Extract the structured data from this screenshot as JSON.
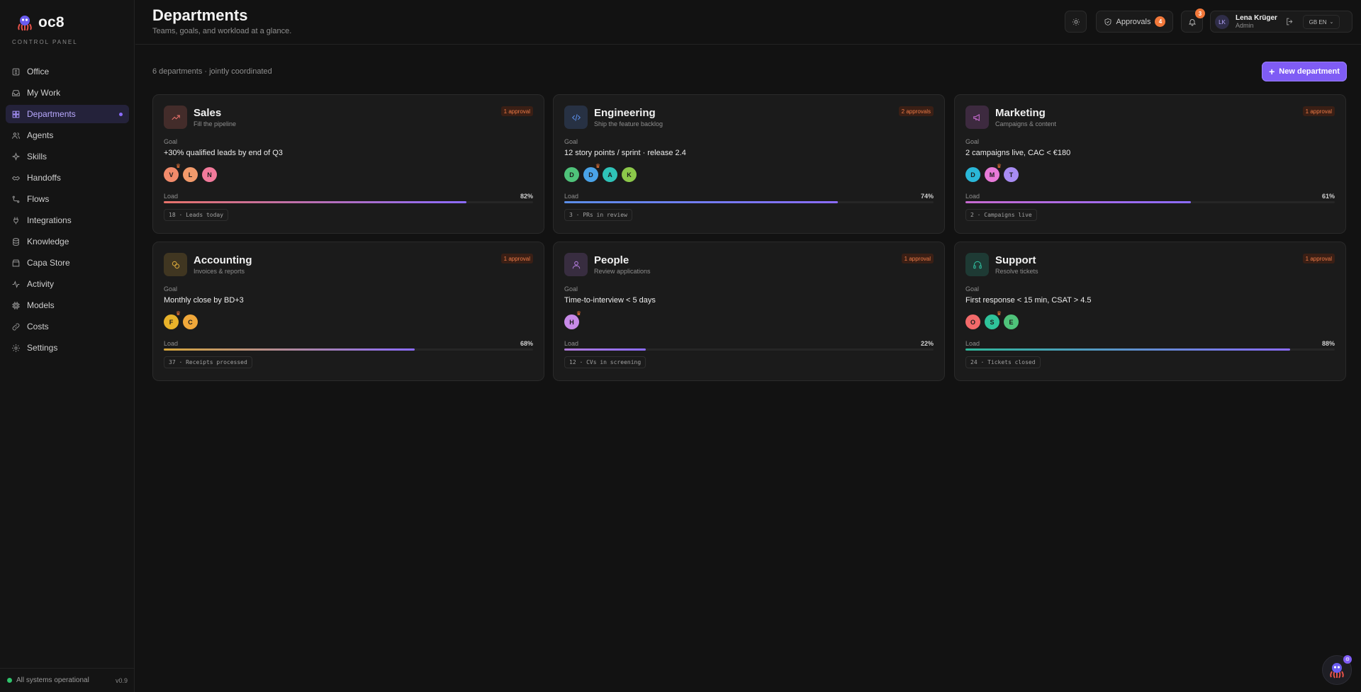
{
  "brand": {
    "name": "oc8",
    "subtitle": "CONTROL PANEL",
    "logo_icon": "octopus-icon"
  },
  "sidebar": {
    "items": [
      {
        "label": "Office",
        "icon": "office-icon"
      },
      {
        "label": "My Work",
        "icon": "inbox-icon"
      },
      {
        "label": "Departments",
        "icon": "grid-icon",
        "active": true
      },
      {
        "label": "Agents",
        "icon": "users-icon"
      },
      {
        "label": "Skills",
        "icon": "sparkle-icon"
      },
      {
        "label": "Handoffs",
        "icon": "handshake-icon"
      },
      {
        "label": "Flows",
        "icon": "flow-icon"
      },
      {
        "label": "Integrations",
        "icon": "plug-icon"
      },
      {
        "label": "Knowledge",
        "icon": "database-icon"
      },
      {
        "label": "Capa Store",
        "icon": "store-icon"
      },
      {
        "label": "Activity",
        "icon": "activity-icon"
      },
      {
        "label": "Models",
        "icon": "cpu-icon"
      },
      {
        "label": "Costs",
        "icon": "link-icon"
      },
      {
        "label": "Settings",
        "icon": "gear-icon"
      }
    ],
    "status": "All systems operational",
    "version": "v0.9"
  },
  "header": {
    "title": "Departments",
    "subtitle": "Teams, goals, and workload at a glance.",
    "approvals_label": "Approvals",
    "approvals_count": "4",
    "notifications_count": "3",
    "user": {
      "initials": "LK",
      "name": "Lena Krüger",
      "role": "Admin"
    },
    "language": "GB EN"
  },
  "main": {
    "count_text": "6 departments · jointly coordinated",
    "new_button": "New department"
  },
  "departments": [
    {
      "name": "Sales",
      "sub": "Fill the pipeline",
      "approvals": "1 approval",
      "goal_label": "Goal",
      "goal": "+30% qualified leads by end of Q3",
      "members": [
        {
          "i": "V",
          "c": "#f28b6b",
          "crown": true
        },
        {
          "i": "L",
          "c": "#f29a6b"
        },
        {
          "i": "N",
          "c": "#f27a9b"
        }
      ],
      "load_label": "Load",
      "load": 82,
      "load_text": "82%",
      "tag": "18 · Leads today",
      "accent": "#e8726a",
      "icon": "trending-up-icon"
    },
    {
      "name": "Engineering",
      "sub": "Ship the feature backlog",
      "approvals": "2 approvals",
      "goal_label": "Goal",
      "goal": "12 story points / sprint · release 2.4",
      "members": [
        {
          "i": "D",
          "c": "#4fc37a"
        },
        {
          "i": "D",
          "c": "#4aa3e8",
          "crown": true
        },
        {
          "i": "A",
          "c": "#2fc3b8"
        },
        {
          "i": "K",
          "c": "#8cc84a"
        }
      ],
      "load_label": "Load",
      "load": 74,
      "load_text": "74%",
      "tag": "3 · PRs in review",
      "accent": "#5b8ee8",
      "icon": "code-icon"
    },
    {
      "name": "Marketing",
      "sub": "Campaigns & content",
      "approvals": "1 approval",
      "goal_label": "Goal",
      "goal": "2 campaigns live, CAC < €180",
      "members": [
        {
          "i": "D",
          "c": "#2ab7d8"
        },
        {
          "i": "M",
          "c": "#e87ad8",
          "crown": true
        },
        {
          "i": "T",
          "c": "#a88cf2"
        }
      ],
      "load_label": "Load",
      "load": 61,
      "load_text": "61%",
      "tag": "2 · Campaigns live",
      "accent": "#c86ad0",
      "icon": "megaphone-icon"
    },
    {
      "name": "Accounting",
      "sub": "Invoices & reports",
      "approvals": "1 approval",
      "goal_label": "Goal",
      "goal": "Monthly close by BD+3",
      "members": [
        {
          "i": "F",
          "c": "#e8b22a",
          "crown": true
        },
        {
          "i": "C",
          "c": "#f0a83a"
        }
      ],
      "load_label": "Load",
      "load": 68,
      "load_text": "68%",
      "tag": "37 · Receipts processed",
      "accent": "#d6a63a",
      "icon": "coins-icon"
    },
    {
      "name": "People",
      "sub": "Review applications",
      "approvals": "1 approval",
      "goal_label": "Goal",
      "goal": "Time-to-interview < 5 days",
      "members": [
        {
          "i": "H",
          "c": "#c88ae8",
          "crown": true
        }
      ],
      "load_label": "Load",
      "load": 22,
      "load_text": "22%",
      "tag": "12 · CVs in screening",
      "accent": "#b07ad8",
      "icon": "user-icon"
    },
    {
      "name": "Support",
      "sub": "Resolve tickets",
      "approvals": "1 approval",
      "goal_label": "Goal",
      "goal": "First response < 15 min, CSAT > 4.5",
      "members": [
        {
          "i": "O",
          "c": "#f26a6a"
        },
        {
          "i": "S",
          "c": "#2fc39a",
          "crown": true
        },
        {
          "i": "E",
          "c": "#4fc37a"
        }
      ],
      "load_label": "Load",
      "load": 88,
      "load_text": "88%",
      "tag": "24 · Tickets closed",
      "accent": "#2fb89a",
      "icon": "headphones-icon"
    }
  ],
  "colors": {
    "accent": "#7f5cf5",
    "approval_badge": "#f2783a",
    "status_ok": "#2fc36b"
  }
}
